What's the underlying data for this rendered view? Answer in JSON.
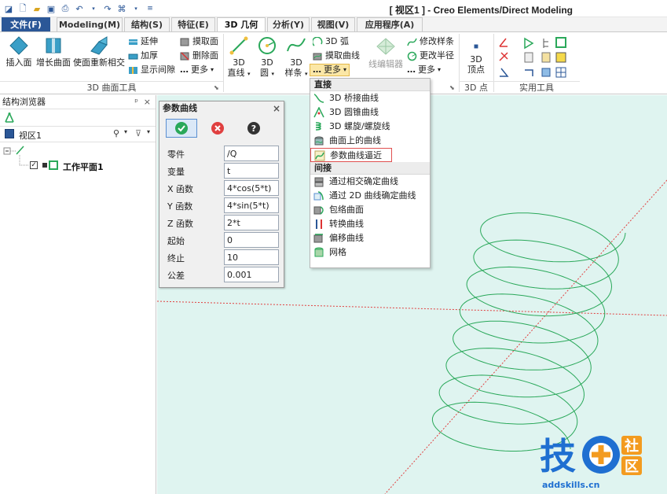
{
  "titlebar": {
    "title": "[ 视区1 ] - Creo Elements/Direct Modeling"
  },
  "tabs": [
    {
      "label": "文件(F)"
    },
    {
      "label": "Modeling(M)"
    },
    {
      "label": "结构(S)"
    },
    {
      "label": "特征(E)"
    },
    {
      "label": "3D 几何"
    },
    {
      "label": "分析(Y)"
    },
    {
      "label": "视图(V)"
    },
    {
      "label": "应用程序(A)"
    }
  ],
  "ribbon": {
    "surface_group": {
      "label": "3D 曲面工具",
      "insert_face": "插入面",
      "extend_surface": "增长曲面",
      "intersect": "使面重新相交",
      "extend": "延伸",
      "thicken": "加厚",
      "show_gap": "显示间隙",
      "extract_face": "摸取面",
      "delete_face": "删除面",
      "more": "更多"
    },
    "curve_group": {
      "line_top": "3D",
      "line_bottom": "直线",
      "circle_top": "3D",
      "circle_bottom": "圆",
      "spline_top": "3D",
      "spline_bottom": "样条",
      "arc": "3D 弧",
      "extract_curve": "摸取曲线",
      "more": "更多",
      "wire_editor": "线编辑器",
      "modify_spline": "修改样条",
      "change_radius": "更改半径",
      "more2": "更多"
    },
    "point_group": {
      "label": "3D 点",
      "vertex_top": "3D",
      "vertex_bottom": "顶点"
    },
    "util_group": {
      "label": "实用工具"
    }
  },
  "browser": {
    "title": "结构浏览器",
    "pin": "ᵖ",
    "close": "×",
    "view_label": "视区1",
    "workplane": "工作平面1"
  },
  "dialog": {
    "title": "参数曲线",
    "close": "×",
    "rows": [
      {
        "label": "零件",
        "value": "/Q"
      },
      {
        "label": "变量",
        "value": "t"
      },
      {
        "label": "X 函数",
        "value": "4*cos(5*t)"
      },
      {
        "label": "Y 函数",
        "value": "4*sin(5*t)"
      },
      {
        "label": "Z 函数",
        "value": "2*t"
      },
      {
        "label": "起始",
        "value": "0"
      },
      {
        "label": "终止",
        "value": "10"
      },
      {
        "label": "公差",
        "value": "0.001"
      }
    ]
  },
  "dropdown": {
    "direct_header": "直接",
    "direct_items": [
      {
        "label": "3D 桥接曲线"
      },
      {
        "label": "3D 圆锥曲线"
      },
      {
        "label": "3D 螺旋/螺旋线"
      },
      {
        "label": "曲面上的曲线"
      },
      {
        "label": "参数曲线逼近"
      }
    ],
    "indirect_header": "间接",
    "indirect_items": [
      {
        "label": "通过相交确定曲线"
      },
      {
        "label": "通过 2D 曲线确定曲线"
      },
      {
        "label": "包络曲面"
      },
      {
        "label": "转换曲线"
      },
      {
        "label": "偏移曲线"
      },
      {
        "label": "网格"
      }
    ]
  },
  "watermark": {
    "url": "addskills.cn",
    "char_tech": "技",
    "char_she": "社",
    "char_qu": "区"
  },
  "colors": {
    "viewport_bg": "#dff4f0",
    "helix": "#2aa85a",
    "axis": "#e04040",
    "accent_blue": "#1f6fd1",
    "accent_orange": "#f39b1f"
  }
}
